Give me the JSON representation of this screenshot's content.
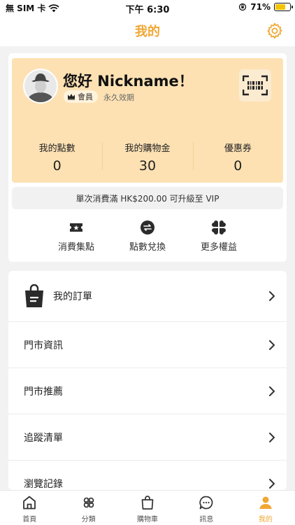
{
  "status_bar": {
    "carrier": "無 SIM 卡",
    "time": "下午 6:30",
    "battery_percent": "71%",
    "battery_level": 0.71
  },
  "header": {
    "title": "我的"
  },
  "profile": {
    "greeting": "您好 Nickname！",
    "badge": "會員",
    "validity": "永久效期"
  },
  "stats": [
    {
      "label": "我的點數",
      "value": "0"
    },
    {
      "label": "我的購物金",
      "value": "30"
    },
    {
      "label": "優惠券",
      "value": "0"
    }
  ],
  "upgrade_notice": "單次消費滿 HK$200.00 可升級至 VIP",
  "quick_actions": [
    {
      "label": "消費集點",
      "icon": "ticket-star-icon"
    },
    {
      "label": "點數兌換",
      "icon": "exchange-icon"
    },
    {
      "label": "更多權益",
      "icon": "clover-icon"
    }
  ],
  "menu": [
    {
      "label": "我的訂單",
      "icon": "shopping-bag-icon"
    },
    {
      "label": "門市資訊"
    },
    {
      "label": "門市推薦"
    },
    {
      "label": "追蹤清單"
    },
    {
      "label": "瀏覽記錄"
    }
  ],
  "bottom_nav": [
    {
      "label": "首頁",
      "icon": "home-icon"
    },
    {
      "label": "分類",
      "icon": "category-icon"
    },
    {
      "label": "購物車",
      "icon": "cart-bag-icon"
    },
    {
      "label": "訊息",
      "icon": "chat-icon"
    },
    {
      "label": "我的",
      "icon": "person-icon",
      "active": true
    }
  ],
  "colors": {
    "accent": "#f0a733",
    "card": "#fde1b3",
    "background": "#f2f2f2"
  }
}
